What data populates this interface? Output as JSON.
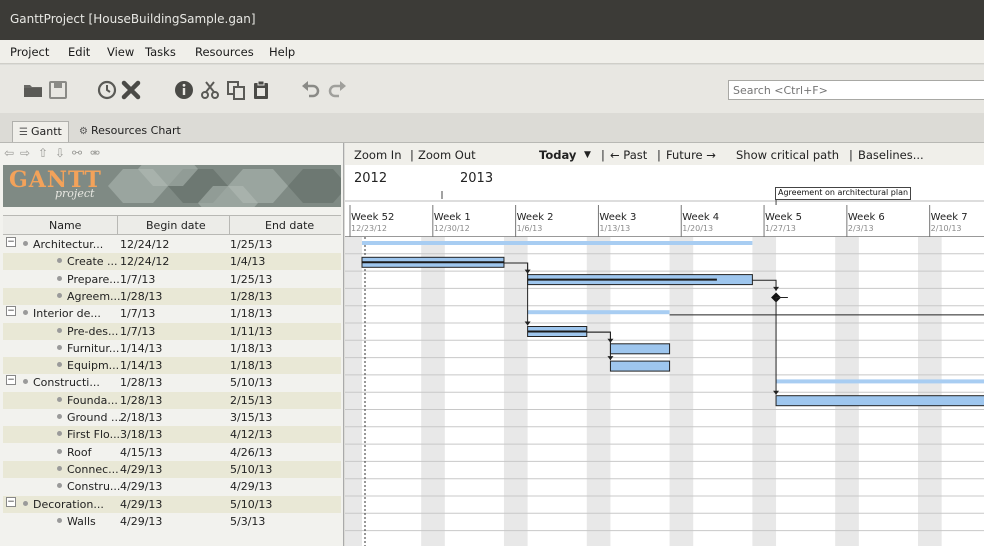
{
  "window": {
    "title": "GanttProject [HouseBuildingSample.gan]"
  },
  "menu": [
    "Project",
    "Edit",
    "View",
    "Tasks",
    "Resources",
    "Help"
  ],
  "search": {
    "placeholder": "Search <Ctrl+F>"
  },
  "tabs": [
    {
      "label": "Gantt",
      "icon": "gantt-tab-icon"
    },
    {
      "label": "Resources Chart",
      "icon": "resources-tab-icon"
    }
  ],
  "logo": {
    "word": "GANTT",
    "sub": "project"
  },
  "table": {
    "columns": [
      "Name",
      "Begin date",
      "End date"
    ],
    "rows": [
      {
        "name": "Architectur...",
        "begin": "12/24/12",
        "end": "1/25/13",
        "level": 0,
        "group": true
      },
      {
        "name": "Create ...",
        "begin": "12/24/12",
        "end": "1/4/13",
        "level": 1,
        "group": false
      },
      {
        "name": "Prepare...",
        "begin": "1/7/13",
        "end": "1/25/13",
        "level": 1,
        "group": false
      },
      {
        "name": "Agreem...",
        "begin": "1/28/13",
        "end": "1/28/13",
        "level": 1,
        "group": false
      },
      {
        "name": "Interior de...",
        "begin": "1/7/13",
        "end": "1/18/13",
        "level": 0,
        "group": true
      },
      {
        "name": "Pre-des...",
        "begin": "1/7/13",
        "end": "1/11/13",
        "level": 1,
        "group": false
      },
      {
        "name": "Furnitur...",
        "begin": "1/14/13",
        "end": "1/18/13",
        "level": 1,
        "group": false
      },
      {
        "name": "Equipm...",
        "begin": "1/14/13",
        "end": "1/18/13",
        "level": 1,
        "group": false
      },
      {
        "name": "Constructi...",
        "begin": "1/28/13",
        "end": "5/10/13",
        "level": 0,
        "group": true
      },
      {
        "name": "Founda...",
        "begin": "1/28/13",
        "end": "2/15/13",
        "level": 1,
        "group": false
      },
      {
        "name": "Ground ...",
        "begin": "2/18/13",
        "end": "3/15/13",
        "level": 1,
        "group": false
      },
      {
        "name": "First Flo...",
        "begin": "3/18/13",
        "end": "4/12/13",
        "level": 1,
        "group": false
      },
      {
        "name": "Roof",
        "begin": "4/15/13",
        "end": "4/26/13",
        "level": 1,
        "group": false
      },
      {
        "name": "Connec...",
        "begin": "4/29/13",
        "end": "5/10/13",
        "level": 1,
        "group": false
      },
      {
        "name": "Constru...",
        "begin": "4/29/13",
        "end": "4/29/13",
        "level": 1,
        "group": false
      },
      {
        "name": "Decoration...",
        "begin": "4/29/13",
        "end": "5/10/13",
        "level": 0,
        "group": true
      },
      {
        "name": "Walls",
        "begin": "4/29/13",
        "end": "5/3/13",
        "level": 1,
        "group": false
      }
    ]
  },
  "chart_toolbar": {
    "zoom_in": "Zoom In",
    "sep1": "|",
    "zoom_out": "Zoom Out",
    "today": "Today",
    "today_arrow": "▼",
    "sep2": "|",
    "past": "← Past",
    "sep3": "|",
    "future": "Future →",
    "critical_path": "Show critical path",
    "sep4": "|",
    "baselines": "Baselines..."
  },
  "timeline": {
    "years": [
      "2012",
      "2013"
    ],
    "weeks": [
      {
        "label": "Week 52",
        "date": "12/23/12"
      },
      {
        "label": "Week 1",
        "date": "12/30/12"
      },
      {
        "label": "Week 2",
        "date": "1/6/13"
      },
      {
        "label": "Week 3",
        "date": "1/13/13"
      },
      {
        "label": "Week 4",
        "date": "1/20/13"
      },
      {
        "label": "Week 5",
        "date": "1/27/13"
      },
      {
        "label": "Week 6",
        "date": "2/3/13"
      },
      {
        "label": "Week 7",
        "date": "2/10/13"
      }
    ],
    "milestone_label": "Agreement on architectural plan"
  },
  "colors": {
    "bar_fill": "#9ec6ee",
    "summary_bar": "#a8cdf2",
    "progress": "#1a1a1a",
    "weekend": "#e8e8e8",
    "row_alt": "#e9e8d6"
  }
}
